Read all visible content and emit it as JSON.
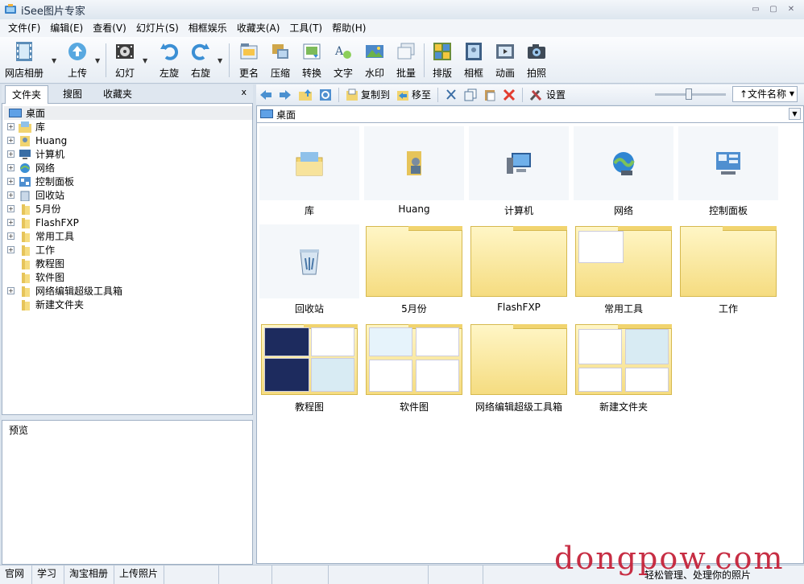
{
  "window": {
    "title": "iSee图片专家",
    "minimize": "▭",
    "maximize": "▢",
    "close": "✕"
  },
  "menu": [
    "文件(F)",
    "编辑(E)",
    "查看(V)",
    "幻灯片(S)",
    "相框娱乐",
    "收藏夹(A)",
    "工具(T)",
    "帮助(H)"
  ],
  "toolbar": {
    "buttons": [
      "网店相册",
      "上传",
      "幻灯",
      "左旋",
      "右旋",
      "更名",
      "压缩",
      "转换",
      "文字",
      "水印",
      "批量",
      "排版",
      "相框",
      "动画",
      "拍照"
    ]
  },
  "left_tabs": {
    "tab1": "文件夹",
    "tab2": "搜图",
    "tab3": "收藏夹",
    "close": "x"
  },
  "tree": {
    "root": "桌面",
    "items": [
      "库",
      "Huang",
      "计算机",
      "网络",
      "控制面板",
      "回收站",
      "5月份",
      "FlashFXP",
      "常用工具",
      "工作",
      "教程图",
      "软件图",
      "网络编辑超级工具箱",
      "新建文件夹"
    ]
  },
  "preview": {
    "title": "预览"
  },
  "nav": {
    "copy_to": "复制到",
    "move_to": "移至",
    "settings": "设置",
    "sort": "↑文件名称"
  },
  "address": {
    "path": "桌面"
  },
  "grid": {
    "items": [
      "库",
      "Huang",
      "计算机",
      "网络",
      "控制面板",
      "回收站",
      "5月份",
      "FlashFXP",
      "常用工具",
      "工作",
      "教程图",
      "软件图",
      "网络编辑超级工具箱",
      "新建文件夹"
    ]
  },
  "status": {
    "cells": [
      "官网",
      "学习",
      "淘宝相册",
      "上传照片"
    ],
    "message": "轻松管理、处理你的照片"
  },
  "watermark": "dongpow.com",
  "colors": {
    "accent": "#3a6ea5",
    "folder": "#f5dc80",
    "watermark": "#c5233a"
  }
}
